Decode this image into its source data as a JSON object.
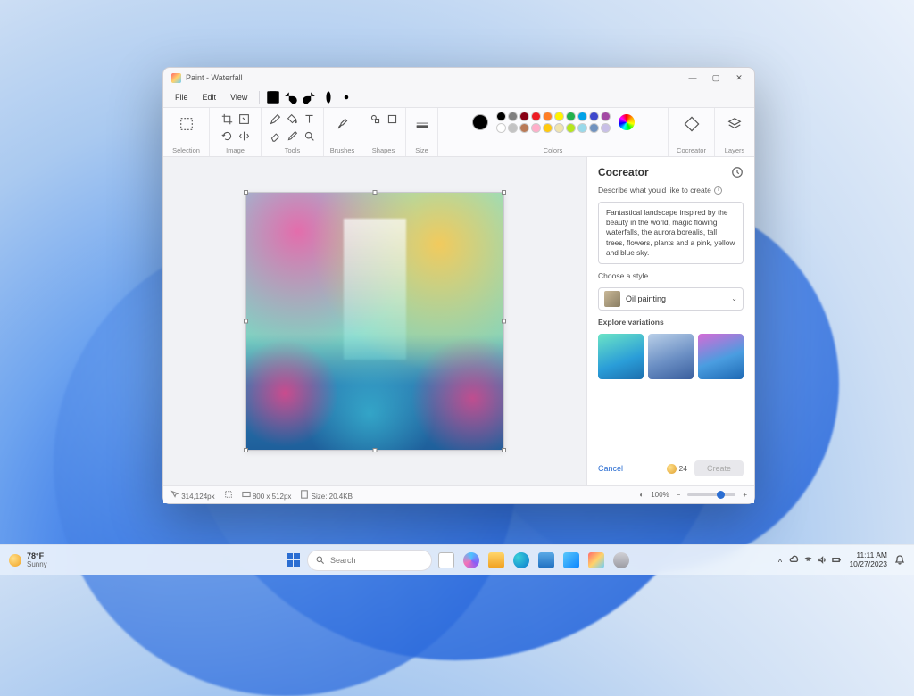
{
  "window": {
    "title": "Paint - Waterfall",
    "menus": {
      "file": "File",
      "edit": "Edit",
      "view": "View"
    }
  },
  "ribbon": {
    "groups": {
      "selection": "Selection",
      "image": "Image",
      "tools": "Tools",
      "brushes": "Brushes",
      "shapes": "Shapes",
      "size": "Size",
      "colors": "Colors",
      "cocreator": "Cocreator",
      "layers": "Layers"
    },
    "main_color": "#000000",
    "palette_row1": [
      "#000000",
      "#7f7f7f",
      "#880015",
      "#ed1c24",
      "#ff7f27",
      "#fff200",
      "#22b14c",
      "#00a2e8",
      "#3f48cc",
      "#a349a4"
    ],
    "palette_row2": [
      "#ffffff",
      "#c3c3c3",
      "#b97a57",
      "#ffaec9",
      "#ffc90e",
      "#efe4b0",
      "#b5e61d",
      "#99d9ea",
      "#7092be",
      "#c8bfe7"
    ]
  },
  "cocreator": {
    "title": "Cocreator",
    "describe_label": "Describe what you'd like to create",
    "prompt": "Fantastical landscape inspired by the beauty in the world, magic flowing waterfalls, the aurora borealis, tall trees, flowers, plants and a pink, yellow and blue sky.",
    "style_label": "Choose a style",
    "style_value": "Oil painting",
    "variations_label": "Explore variations",
    "cancel": "Cancel",
    "credits": "24",
    "create": "Create"
  },
  "status": {
    "cursor": "314,124px",
    "dimensions": "800 x 512px",
    "size": "Size: 20.4KB",
    "zoom": "100%"
  },
  "taskbar": {
    "weather_temp": "78°F",
    "weather_cond": "Sunny",
    "search_placeholder": "Search",
    "time": "11:11 AM",
    "date": "10/27/2023"
  }
}
